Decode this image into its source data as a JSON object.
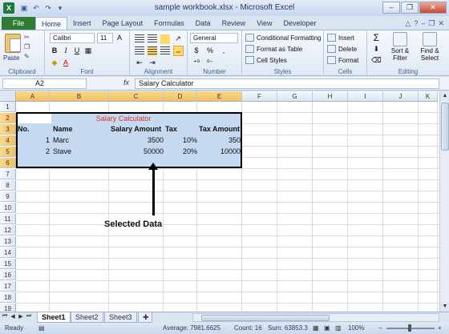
{
  "window": {
    "title": "sample workbook.xlsx - Microsoft Excel",
    "app_icon": "X",
    "min": "–",
    "max": "❐",
    "close": "✕"
  },
  "tabs": {
    "file": "File",
    "items": [
      "Home",
      "Insert",
      "Page Layout",
      "Formulas",
      "Data",
      "Review",
      "View",
      "Developer"
    ],
    "active": "Home"
  },
  "ribbon": {
    "clipboard": {
      "paste": "Paste",
      "label": "Clipboard"
    },
    "font": {
      "name": "Calibri",
      "size": "11",
      "label": "Font",
      "bold": "B",
      "italic": "I",
      "underline": "U",
      "grow": "A",
      "shrink": "A",
      "fill": "◆",
      "color": "A"
    },
    "alignment": {
      "label": "Alignment"
    },
    "number": {
      "format": "General",
      "currency": "$",
      "percent": "%",
      "comma": ",",
      "label": "Number"
    },
    "styles": {
      "conditional": "Conditional Formatting",
      "table": "Format as Table",
      "cell": "Cell Styles",
      "label": "Styles"
    },
    "cells": {
      "insert": "Insert",
      "delete": "Delete",
      "format": "Format",
      "label": "Cells"
    },
    "editing": {
      "sort": "Sort &",
      "sort2": "Filter",
      "find": "Find &",
      "find2": "Select",
      "label": "Editing"
    }
  },
  "formula_bar": {
    "name_box": "A2",
    "fx": "fx",
    "formula": "Salary Calculator"
  },
  "columns": [
    "A",
    "B",
    "C",
    "D",
    "E",
    "F",
    "G",
    "H",
    "I",
    "J",
    "K"
  ],
  "rows": [
    "1",
    "2",
    "3",
    "4",
    "5",
    "6",
    "7",
    "8",
    "9",
    "10",
    "11",
    "12",
    "13",
    "14",
    "15",
    "16",
    "17",
    "18",
    "19",
    "20"
  ],
  "sheet": {
    "title": "Salary Calculator",
    "headers": [
      "No.",
      "Name",
      "Salary Amount",
      "Tax",
      "Tax Amount"
    ],
    "data": [
      [
        "1",
        "Marc",
        "3500",
        "10%",
        "350"
      ],
      [
        "2",
        "Stave",
        "50000",
        "20%",
        "10000"
      ]
    ]
  },
  "annotation": "Selected Data",
  "sheet_tabs": [
    "Sheet1",
    "Sheet2",
    "Sheet3"
  ],
  "status": {
    "mode": "Ready",
    "average": "Average: 7981.6625",
    "count": "Count: 16",
    "sum": "Sum: 63853.3",
    "zoom": "100%"
  },
  "colors": {
    "selection": "#c5d9f1",
    "title_text": "#e03030",
    "file_tab": "#2e7d32"
  }
}
